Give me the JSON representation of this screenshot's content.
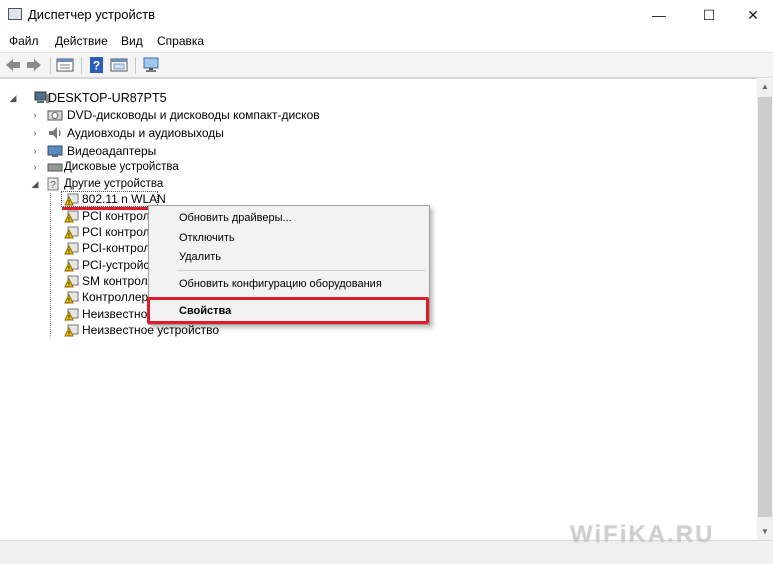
{
  "window": {
    "title": "Диспетчер устройств",
    "minimize": "—",
    "maximize": "☐",
    "close": "✕"
  },
  "menu": [
    "Файл",
    "Действие",
    "Вид",
    "Справка"
  ],
  "toolbar_icons": [
    "back-icon",
    "forward-icon",
    "properties-icon",
    "help-icon",
    "show-hidden-icon",
    "monitor-icon"
  ],
  "tree": {
    "root": "DESKTOP-UR87PT5",
    "categories": [
      {
        "label": "DVD-дисководы и дисководы компакт-дисков",
        "icon": "dvd-icon",
        "expanded": false
      },
      {
        "label": "Аудиовходы и аудиовыходы",
        "icon": "speaker-icon",
        "expanded": false
      },
      {
        "label": "Видеоадаптеры",
        "icon": "display-adapter-icon",
        "expanded": false
      },
      {
        "label": "Дисковые устройства",
        "icon": "disk-drive-icon",
        "expanded": false
      },
      {
        "label": "Другие устройства",
        "icon": "other-devices-icon",
        "expanded": true
      }
    ],
    "other_devices": [
      "802.11 n WLAN",
      "PCI контролл",
      "PCI контролл",
      "PCI-контролл",
      "PCI-устройст",
      "SM контролл",
      "Контроллер у",
      "Неизвестное",
      "Неизвестное устройство"
    ]
  },
  "context_menu": {
    "items": [
      {
        "label": "Обновить драйверы...",
        "bold": false
      },
      {
        "label": "Отключить",
        "bold": false
      },
      {
        "label": "Удалить",
        "bold": false
      },
      {
        "label": "Обновить конфигурацию оборудования",
        "bold": false
      },
      {
        "label": "Свойства",
        "bold": true
      }
    ]
  },
  "watermark": "WiFiKA.RU",
  "colors": {
    "highlight_red": "#e11c2a",
    "warning_yellow": "#f5c400"
  }
}
